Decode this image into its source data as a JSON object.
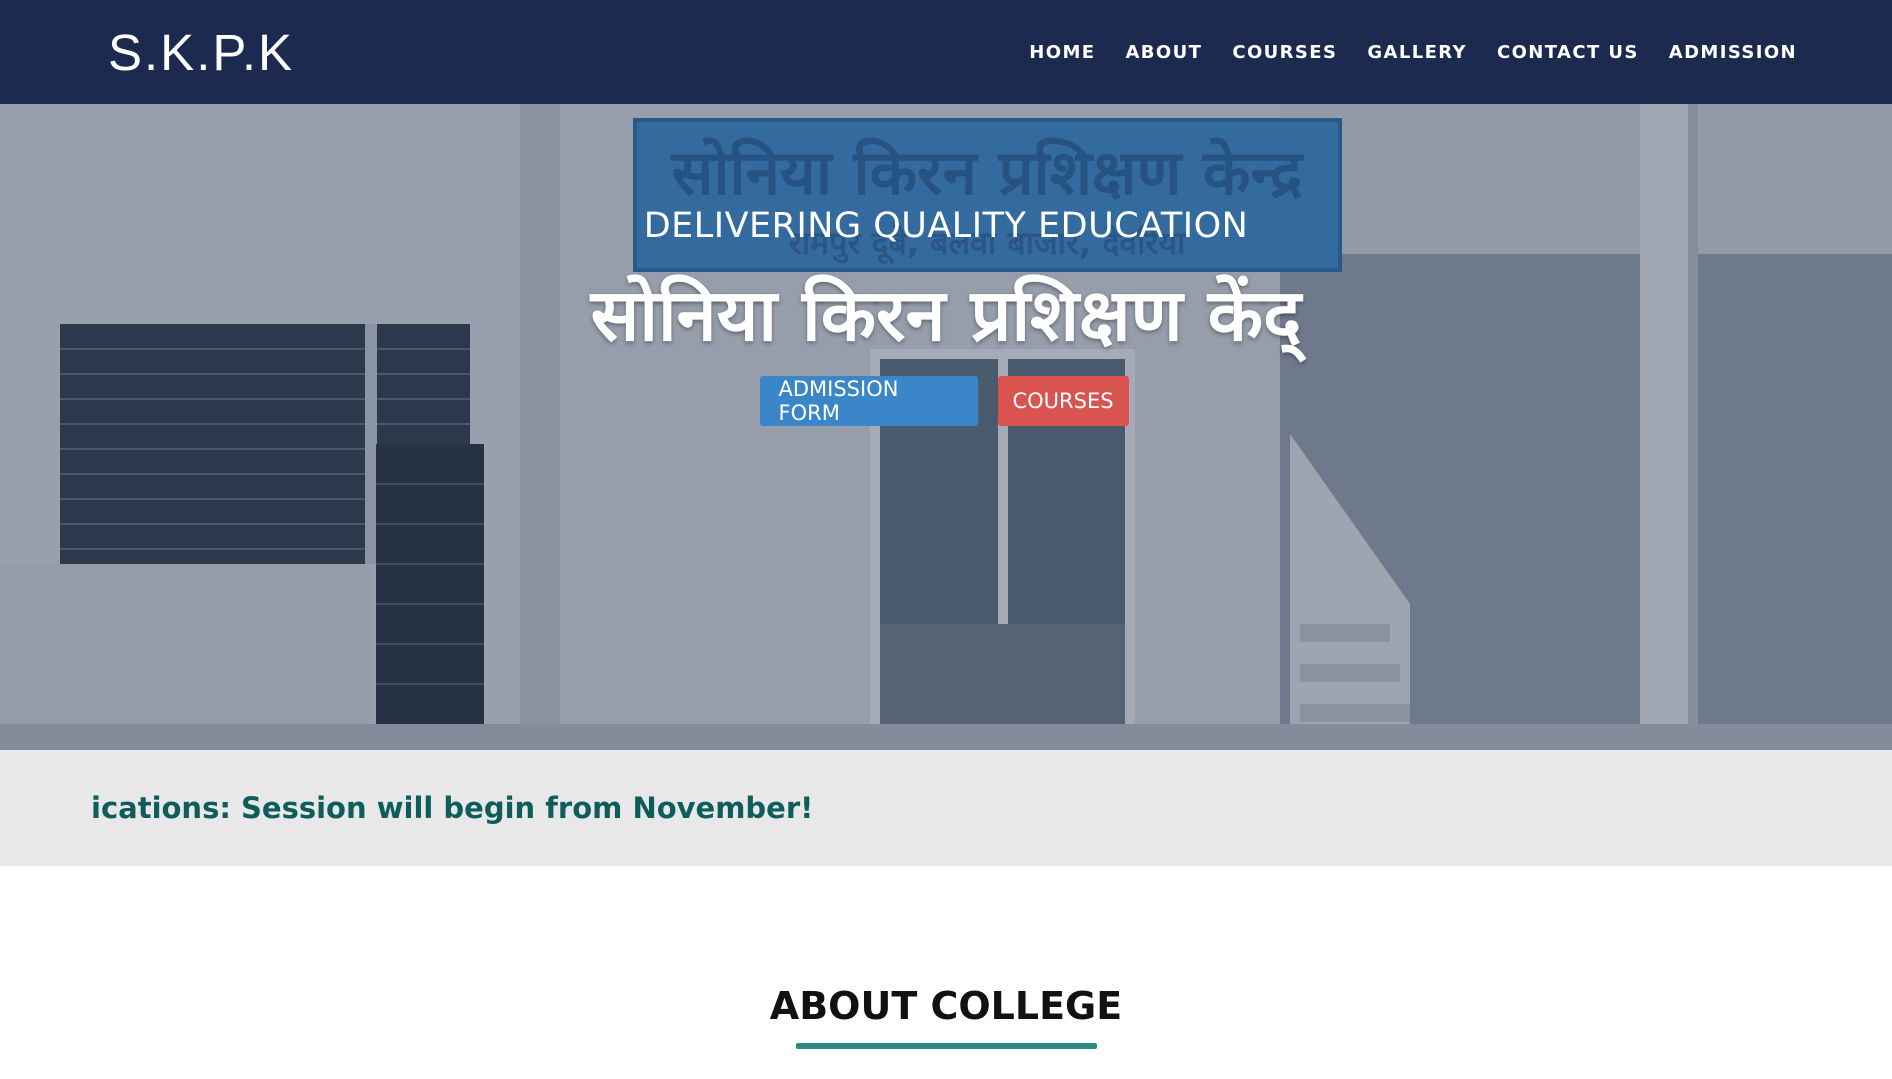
{
  "brand": {
    "logo_text": "S.K.P.K"
  },
  "nav": {
    "items": [
      {
        "label": "HOME"
      },
      {
        "label": "ABOUT"
      },
      {
        "label": "COURSES"
      },
      {
        "label": "GALLERY"
      },
      {
        "label": "CONTACT US"
      },
      {
        "label": "ADMISSION"
      }
    ]
  },
  "hero": {
    "tagline": "DELIVERING QUALITY EDUCATION",
    "title": "सोनिया किरन प्रशिक्षण केंद्",
    "sign_text_line1": "सोनिया किरन प्रशिक्षण केन्द्र",
    "sign_text_line2": "रामपुर दूबे, बलवा बाजार, देवरिया",
    "buttons": {
      "admission_form": "ADMISSION FORM",
      "courses": "COURSES"
    }
  },
  "notice": {
    "text": "ications: Session will begin from November!"
  },
  "about": {
    "title": "ABOUT COLLEGE"
  },
  "colors": {
    "navbar_bg": "#1c2a4f",
    "button_blue": "#3a86c8",
    "button_red": "#d9534f",
    "notice_text": "#0f5c5c",
    "accent_underline": "#2e8a80"
  }
}
